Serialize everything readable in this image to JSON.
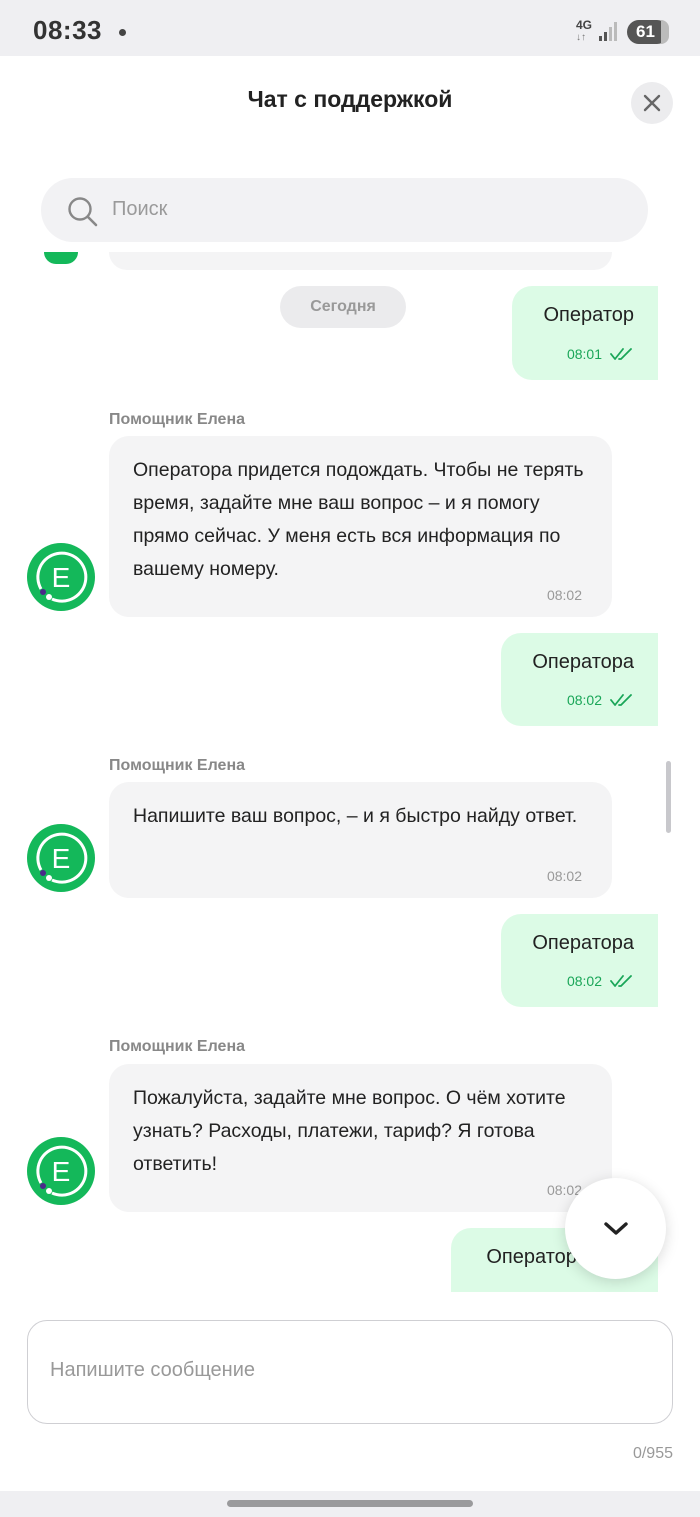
{
  "status_bar": {
    "time": "08:33",
    "network": "4G",
    "battery": "61"
  },
  "header": {
    "title": "Чат с поддержкой",
    "close_icon": "close-icon"
  },
  "search": {
    "placeholder": "Поиск",
    "icon": "search-icon"
  },
  "chat": {
    "date_divider": "Сегодня",
    "messages": [
      {
        "direction": "out",
        "text": "Оператор",
        "time": "08:01",
        "status_icon": "double-check-icon"
      },
      {
        "direction": "in",
        "sender": "Помощник Елена",
        "text": "Оператора придется подождать. Чтобы не терять время, задайте мне ваш вопрос – и я помогу прямо сейчас. У меня есть вся информация по вашему номеру.",
        "time": "08:02",
        "avatar_letter": "E"
      },
      {
        "direction": "out",
        "text": "Оператора",
        "time": "08:02",
        "status_icon": "double-check-icon"
      },
      {
        "direction": "in",
        "sender": "Помощник Елена",
        "text": "Напишите ваш вопрос, – и я быстро найду ответ.",
        "time": "08:02",
        "avatar_letter": "E"
      },
      {
        "direction": "out",
        "text": "Оператора",
        "time": "08:02",
        "status_icon": "double-check-icon"
      },
      {
        "direction": "in",
        "sender": "Помощник Елена",
        "text": "Пожалуйста, задайте мне вопрос. О чём хотите узнать? Расходы, платежи, тариф? Я готова ответить!",
        "time": "08:02",
        "avatar_letter": "E"
      },
      {
        "direction": "out",
        "text": "Оператора",
        "time": "",
        "status_icon": ""
      }
    ]
  },
  "scroll_down_icon": "chevron-down-icon",
  "composer": {
    "placeholder": "Напишите сообщение",
    "counter": "0/955"
  },
  "colors": {
    "accent": "#14b85a",
    "outgoing_bubble": "#dcfbe6",
    "incoming_bubble": "#f4f4f5"
  }
}
